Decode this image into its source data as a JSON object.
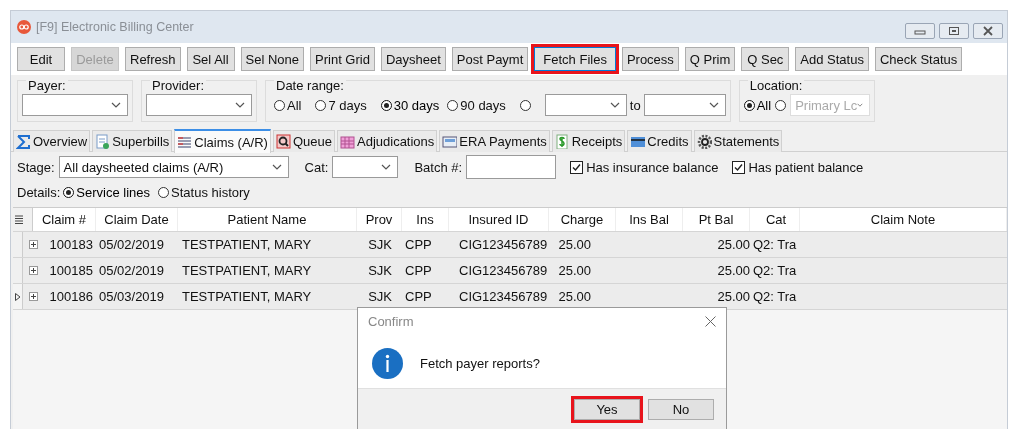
{
  "window": {
    "title": "[F9] Electronic Billing Center"
  },
  "toolbar": [
    {
      "label": "Edit",
      "disabled": false,
      "highlighted": false
    },
    {
      "label": "Delete",
      "disabled": true,
      "highlighted": false
    },
    {
      "label": "Refresh",
      "disabled": false,
      "highlighted": false
    },
    {
      "label": "Sel All",
      "disabled": false,
      "highlighted": false
    },
    {
      "label": "Sel None",
      "disabled": false,
      "highlighted": false
    },
    {
      "label": "Print Grid",
      "disabled": false,
      "highlighted": false
    },
    {
      "label": "Daysheet",
      "disabled": false,
      "highlighted": false
    },
    {
      "label": "Post Paymt",
      "disabled": false,
      "highlighted": false
    },
    {
      "label": "Fetch Files",
      "disabled": false,
      "highlighted": true
    },
    {
      "label": "Process",
      "disabled": false,
      "highlighted": false
    },
    {
      "label": "Q Prim",
      "disabled": false,
      "highlighted": false
    },
    {
      "label": "Q Sec",
      "disabled": false,
      "highlighted": false
    },
    {
      "label": "Add Status",
      "disabled": false,
      "highlighted": false
    },
    {
      "label": "Check Status",
      "disabled": false,
      "highlighted": false
    }
  ],
  "filters": {
    "payer": {
      "label": "Payer:"
    },
    "provider": {
      "label": "Provider:"
    },
    "date_range": {
      "label": "Date range:",
      "to_label": "to",
      "options": [
        {
          "kind": "plain",
          "label": "All",
          "selected": false
        },
        {
          "kind": "plain",
          "label": "7 days",
          "selected": false
        },
        {
          "kind": "plain",
          "label": "30 days",
          "selected": true
        },
        {
          "kind": "plain",
          "label": "90 days",
          "selected": false
        },
        {
          "kind": "custom",
          "selected": false
        }
      ]
    },
    "location": {
      "label": "Location:",
      "options": [
        {
          "kind": "plain",
          "label": "All",
          "selected": true
        },
        {
          "kind": "combo",
          "value": "Primary Lc",
          "selected": false
        }
      ]
    }
  },
  "tabs": [
    {
      "label": "Overview",
      "selected": false
    },
    {
      "label": "Superbills",
      "selected": false
    },
    {
      "label": "Claims (A/R)",
      "selected": true
    },
    {
      "label": "Queue",
      "selected": false
    },
    {
      "label": "Adjudications",
      "selected": false
    },
    {
      "label": "ERA Payments",
      "selected": false
    },
    {
      "label": "Receipts",
      "selected": false
    },
    {
      "label": "Credits",
      "selected": false
    },
    {
      "label": "Statements",
      "selected": false
    }
  ],
  "claims": {
    "stage_label": "Stage:",
    "stage_value": "All daysheeted claims (A/R)",
    "cat_label": "Cat:",
    "batch_label": "Batch #:",
    "checks": [
      {
        "label": "Has insurance balance",
        "checked": true
      },
      {
        "label": "Has patient balance",
        "checked": true
      }
    ],
    "details_label": "Details:",
    "details_options": [
      {
        "label": "Service lines",
        "selected": true
      },
      {
        "label": "Status history",
        "selected": false
      }
    ]
  },
  "table": {
    "columns": [
      "Claim #",
      "Claim Date",
      "Patient Name",
      "Prov",
      "Ins",
      "Insured ID",
      "Charge",
      "Ins Bal",
      "Pt Bal",
      "Cat",
      "Claim Note"
    ],
    "rows": [
      {
        "current": false,
        "cells": [
          "100183",
          "05/02/2019",
          "TESTPATIENT, MARY",
          "SJK",
          "CPP",
          "CIG123456789",
          "25.00",
          "",
          "25.00",
          "Q2: Tra",
          ""
        ]
      },
      {
        "current": false,
        "cells": [
          "100185",
          "05/02/2019",
          "TESTPATIENT, MARY",
          "SJK",
          "CPP",
          "CIG123456789",
          "25.00",
          "",
          "25.00",
          "Q2: Tra",
          ""
        ]
      },
      {
        "current": true,
        "cells": [
          "100186",
          "05/03/2019",
          "TESTPATIENT, MARY",
          "SJK",
          "CPP",
          "CIG123456789",
          "25.00",
          "",
          "25.00",
          "Q2: Tra",
          ""
        ]
      }
    ]
  },
  "dialog": {
    "title": "Confirm",
    "message": "Fetch payer reports?",
    "buttons": [
      {
        "label": "Yes",
        "highlighted": true
      },
      {
        "label": "No",
        "highlighted": false
      }
    ]
  }
}
